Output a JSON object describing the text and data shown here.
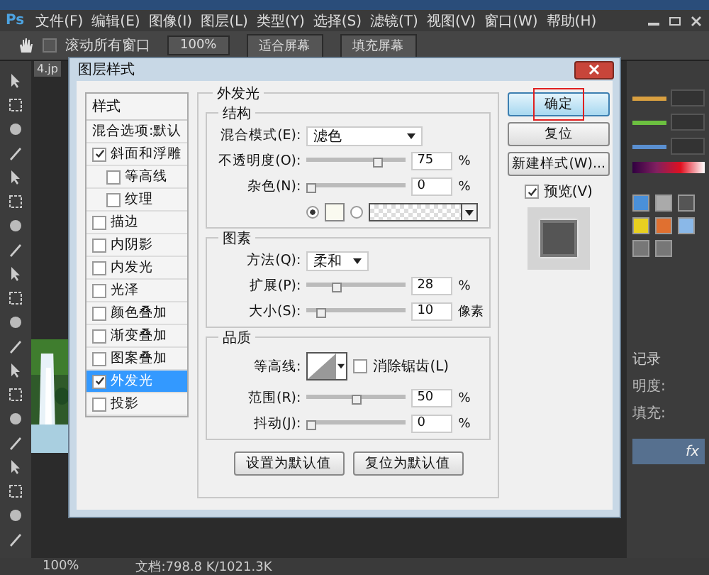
{
  "menu_bar": {
    "logo": "Ps",
    "items": [
      "文件(F)",
      "编辑(E)",
      "图像(I)",
      "图层(L)",
      "类型(Y)",
      "选择(S)",
      "滤镜(T)",
      "视图(V)",
      "窗口(W)",
      "帮助(H)"
    ]
  },
  "options_bar": {
    "scroll_all": {
      "label": "滚动所有窗口",
      "checked": false
    },
    "buttons": [
      "100%",
      "适合屏幕",
      "填充屏幕"
    ]
  },
  "document_tab": {
    "label": "4.jp"
  },
  "dialog": {
    "title": "图层样式",
    "styles_header": "样式",
    "blend_options": "混合选项:默认",
    "styles": [
      {
        "label": "斜面和浮雕",
        "checked": true,
        "selected": false,
        "children": [
          {
            "label": "等高线",
            "checked": false,
            "selected": false
          },
          {
            "label": "纹理",
            "checked": false,
            "selected": false
          }
        ]
      },
      {
        "label": "描边",
        "checked": false,
        "selected": false
      },
      {
        "label": "内阴影",
        "checked": false,
        "selected": false
      },
      {
        "label": "内发光",
        "checked": false,
        "selected": false
      },
      {
        "label": "光泽",
        "checked": false,
        "selected": false
      },
      {
        "label": "颜色叠加",
        "checked": false,
        "selected": false
      },
      {
        "label": "渐变叠加",
        "checked": false,
        "selected": false
      },
      {
        "label": "图案叠加",
        "checked": false,
        "selected": false
      },
      {
        "label": "外发光",
        "checked": true,
        "selected": true
      },
      {
        "label": "投影",
        "checked": false,
        "selected": false
      }
    ],
    "panel_title": "外发光",
    "sections": [
      {
        "title": "结构",
        "rows": [
          {
            "kind": "dropdown",
            "label": "混合模式(E):",
            "value": "滤色",
            "wide": true
          },
          {
            "kind": "slider",
            "label": "不透明度(O):",
            "level": 0.75,
            "value": "75",
            "unit": "%"
          },
          {
            "kind": "slider",
            "label": "杂色(N):",
            "level": 0,
            "value": "0",
            "unit": "%"
          },
          {
            "kind": "color",
            "solid_selected": true
          }
        ]
      },
      {
        "title": "图素",
        "rows": [
          {
            "kind": "dropdown",
            "label": "方法(Q):",
            "value": "柔和",
            "wide": false
          },
          {
            "kind": "slider",
            "label": "扩展(P):",
            "level": 0.28,
            "value": "28",
            "unit": "%"
          },
          {
            "kind": "slider",
            "label": "大小(S):",
            "level": 0.1,
            "value": "10",
            "unit": "像素"
          }
        ]
      },
      {
        "title": "品质",
        "rows": [
          {
            "kind": "contour",
            "label": "等高线:",
            "anti_alias": {
              "label": "消除锯齿(L)",
              "checked": false
            }
          },
          {
            "kind": "slider",
            "label": "范围(R):",
            "level": 0.5,
            "value": "50",
            "unit": "%"
          },
          {
            "kind": "slider",
            "label": "抖动(J):",
            "level": 0,
            "value": "0",
            "unit": "%"
          }
        ]
      }
    ],
    "default_buttons": [
      "设置为默认值",
      "复位为默认值"
    ],
    "action_buttons": [
      {
        "label": "确定",
        "highlighted": true
      },
      {
        "label": "复位",
        "highlighted": false
      },
      {
        "label": "新建样式(W)...",
        "highlighted": false
      }
    ],
    "preview": {
      "label": "预览(V)",
      "checked": true
    }
  },
  "panels": {
    "history_tab": "记录",
    "opacity_label": "明度:",
    "fill_label": "填充:",
    "layer_fx": "fx"
  },
  "status_bar": {
    "zoom": "100%",
    "doc_info": "文档:798.8 K/1021.3K"
  }
}
